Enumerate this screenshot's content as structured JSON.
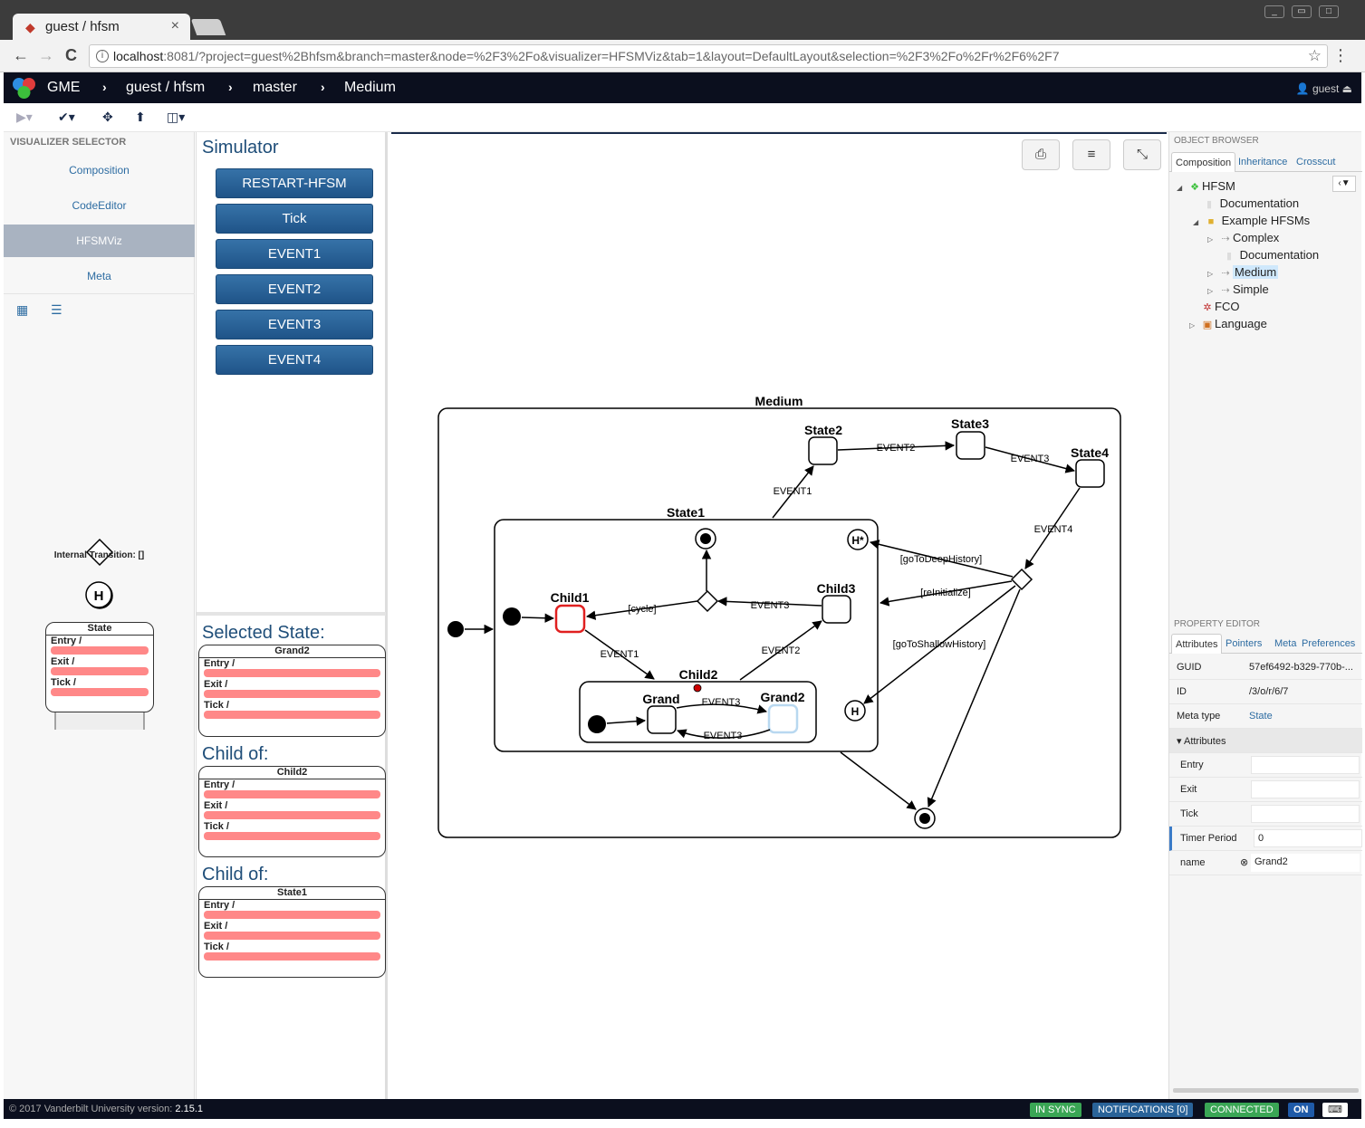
{
  "browser": {
    "tab_title": "guest / hfsm",
    "tab_close": "×",
    "url_host": "localhost",
    "url_rest": ":8081/?project=guest%2Bhfsm&branch=master&node=%2F3%2Fo&visualizer=HFSMViz&tab=1&layout=DefaultLayout&selection=%2F3%2Fo%2Fr%2F6%2F7",
    "back_icon": "←",
    "forward_icon": "→",
    "reload_icon": "C",
    "info_icon": "i",
    "star_icon": "☆",
    "menu_icon": "⋮"
  },
  "header": {
    "app_name": "GME",
    "crumbs": [
      "guest / hfsm",
      "master",
      "Medium"
    ],
    "separator": "›",
    "user": "guest"
  },
  "left": {
    "header": "VISUALIZER SELECTOR",
    "visualizers": [
      "Composition",
      "CodeEditor",
      "HFSMViz",
      "Meta"
    ],
    "active": "HFSMViz",
    "internal_transition": "Internal Transition: []",
    "palette_state": {
      "title": "State",
      "entry": "Entry /",
      "exit": "Exit /",
      "tick": "Tick /"
    }
  },
  "simulator": {
    "title": "Simulator",
    "buttons": [
      "RESTART-HFSM",
      "Tick",
      "EVENT1",
      "EVENT2",
      "EVENT3",
      "EVENT4"
    ],
    "selected_state_label": "Selected State:",
    "child_of_label": "Child of:",
    "state_cards": [
      {
        "name": "Grand2",
        "entry": "Entry /",
        "exit": "Exit /",
        "tick": "Tick /"
      },
      {
        "name": "Child2",
        "entry": "Entry /",
        "exit": "Exit /",
        "tick": "Tick /"
      },
      {
        "name": "State1",
        "entry": "Entry /",
        "exit": "Exit /",
        "tick": "Tick /"
      }
    ]
  },
  "diagram": {
    "root": "Medium",
    "states": {
      "state1": "State1",
      "state2": "State2",
      "state3": "State3",
      "state4": "State4",
      "child1": "Child1",
      "child2": "Child2",
      "child3": "Child3",
      "grand": "Grand",
      "grand2": "Grand2"
    },
    "transitions": {
      "s1_s2": "EVENT1",
      "s2_s3": "EVENT2",
      "s3_s4": "EVENT3",
      "s4_choice": "EVENT4",
      "deep": "[goToDeepHistory]",
      "reinit": "[reInitialize]",
      "shallow": "[goToShallowHistory]",
      "cycle": "[cycle]",
      "child3_choice": "EVENT3",
      "c1_c2": "EVENT1",
      "c2_c3": "EVENT2",
      "g_g2": "EVENT3",
      "g2_g": "EVENT3"
    },
    "deep_history": "H*",
    "shallow_history": "H"
  },
  "right": {
    "browser_header": "OBJECT BROWSER",
    "browser_tabs": [
      "Composition",
      "Inheritance",
      "Crosscut"
    ],
    "tree": [
      {
        "label": "HFSM"
      },
      {
        "label": "Documentation"
      },
      {
        "label": "Example HFSMs"
      },
      {
        "label": "Complex"
      },
      {
        "label": "Documentation"
      },
      {
        "label": "Medium"
      },
      {
        "label": "Simple"
      },
      {
        "label": "FCO"
      },
      {
        "label": "Language"
      }
    ],
    "prop_header": "PROPERTY EDITOR",
    "prop_tabs": [
      "Attributes",
      "Pointers",
      "Meta",
      "Preferences"
    ],
    "props": {
      "guid_key": "GUID",
      "guid_val": "57ef6492-b329-770b-...",
      "id_key": "ID",
      "id_val": "/3/o/r/6/7",
      "meta_key": "Meta type",
      "meta_val": "State",
      "attributes": "Attributes",
      "entry": "Entry",
      "exit": "Exit",
      "tick": "Tick",
      "timer": "Timer Period",
      "timer_val": "0",
      "name": "name",
      "name_val": "Grand2"
    }
  },
  "footer": {
    "copyright": "© 2017 Vanderbilt University",
    "version_label": "version:",
    "version": "2.15.1",
    "in_sync": "IN SYNC",
    "notifications": "NOTIFICATIONS [0]",
    "connected": "CONNECTED",
    "on": "ON"
  },
  "colors": {
    "header_bg": "#0b0f1e",
    "button_blue": "#2a6399",
    "active_state": "#e02020",
    "selected_state": "#b8d8f0",
    "in_sync": "#3aa655",
    "notifications": "#2a6399"
  }
}
